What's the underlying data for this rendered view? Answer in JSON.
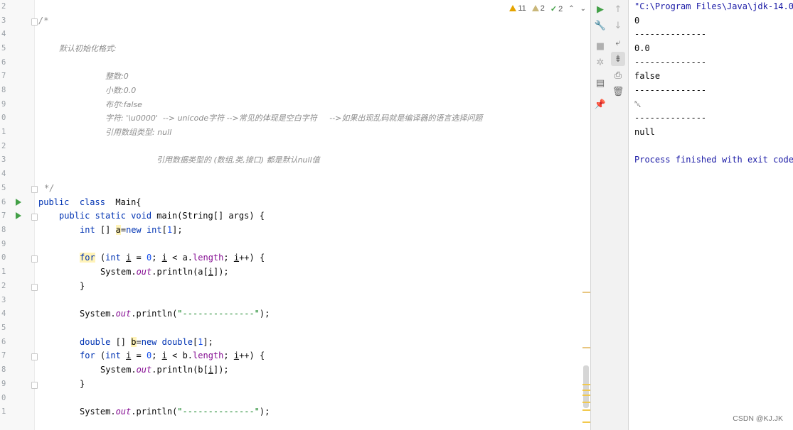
{
  "inspections": {
    "warnings": "11",
    "weak_warnings": "2",
    "typos": "2"
  },
  "line_numbers": [
    "2",
    "3",
    "4",
    "5",
    "6",
    "7",
    "8",
    "9",
    "0",
    "1",
    "2",
    "3",
    "4",
    "5",
    "6",
    "7",
    "8",
    "9",
    "0",
    "1",
    "2",
    "3",
    "4",
    "5",
    "6",
    "7",
    "8",
    "9",
    "0",
    "1"
  ],
  "code": {
    "l3": "/*",
    "l5": "默认初始化格式:",
    "l7": "整数:0",
    "l8": "小数:0.0",
    "l9": "布尔:false",
    "l10_a": "字符: '\\u0000'  --> unicode字符 -->常见的体现是空白字符     -->如果出现乱码就是编译器的语言选择问题",
    "l11": "引用数组类型: null",
    "l13": "引用数据类型的 (数组,类,接口) 都是默认null值",
    "l15": "*/",
    "l16_kw1": "public",
    "l16_kw2": "class",
    "l16_rest": "Main{",
    "l17_kw": "public static void",
    "l17_rest": "main(String[] args) {",
    "l18_type": "int",
    "l18_b": " [] ",
    "l18_var": "a",
    "l18_eq": "=",
    "l18_new": "new int",
    "l18_open": "[",
    "l18_num": "1",
    "l18_close": "];",
    "for_kw": "for",
    "l20_a": " (",
    "l20_int": "int",
    "l20_sp": " ",
    "l20_i": "i",
    "l20_eq": " = ",
    "l20_zero": "0",
    "l20_semi": "; ",
    "l20_i2": "i",
    "l20_lt": " < a.",
    "l20_len": "length",
    "l20_semi2": "; ",
    "l20_i3": "i",
    "l20_end": "++) {",
    "sys": "System.",
    "out": "out",
    "l21_rest_a": ".println(a[",
    "l21_i": "i",
    "l21_rest_b": "]);",
    "close_brace": "}",
    "println_open": ".println(",
    "dash_str": "\"--------------\"",
    "println_close": ");",
    "l26_type": "double",
    "l26_b": " [] ",
    "l26_var": "b",
    "l26_eq": "=",
    "l26_new": "new double",
    "l26_open": "[",
    "l26_num": "1",
    "l26_close": "];",
    "l27_lt": " < b.",
    "l28_rest_a": ".println(b["
  },
  "console": {
    "line1": "\"C:\\Program Files\\Java\\jdk-14.0",
    "line2": "0",
    "line3": "--------------",
    "line4": "0.0",
    "line5": "--------------",
    "line6": "false",
    "line7": "--------------",
    "line8": "␀",
    "line9": "--------------",
    "line10": "null",
    "line12": "Process finished with exit code"
  },
  "watermark": "CSDN @KJ.JK",
  "icons": [
    "warning-icon",
    "weak-warning-icon",
    "typo-icon",
    "chevron-up-icon",
    "chevron-down-icon",
    "run-icon",
    "wrench-icon",
    "stop-icon",
    "debug-icon",
    "layout-icon",
    "pin-icon",
    "arrow-up-icon",
    "arrow-down-icon",
    "soft-wrap-icon",
    "scroll-to-end-icon",
    "print-icon",
    "trash-icon"
  ],
  "colors": {
    "keyword": "#0033b3",
    "number": "#1750eb",
    "string": "#067d17",
    "field": "#871094",
    "comment": "#8c8c8c",
    "run": "#43a047"
  }
}
